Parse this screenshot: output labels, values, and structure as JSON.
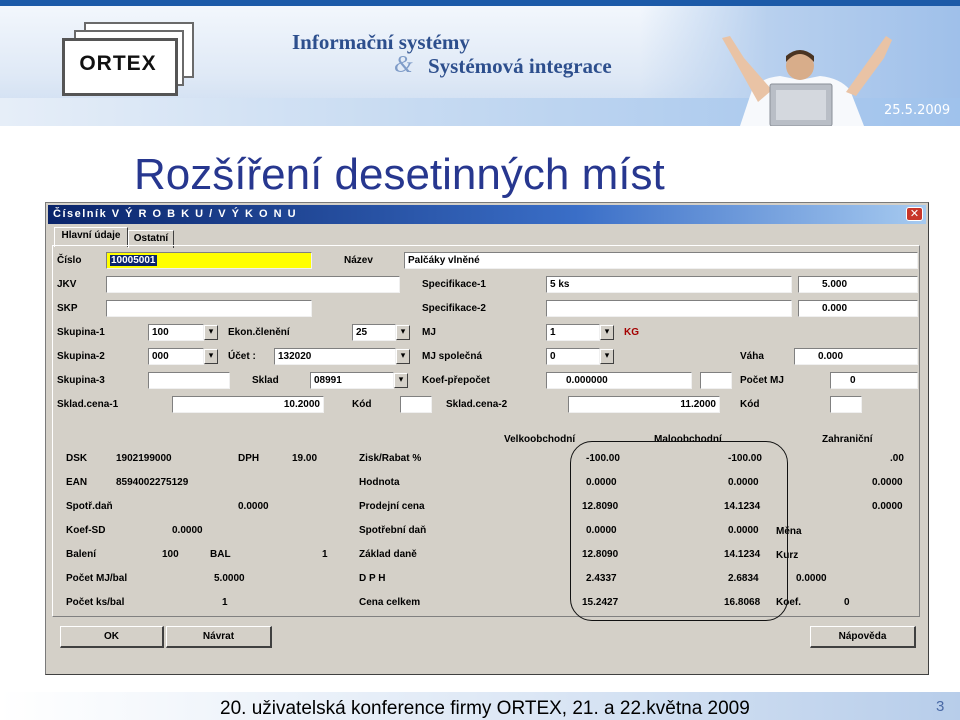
{
  "banner": {
    "logo_text": "ORTEX",
    "tagline_1": "Informační systémy",
    "tagline_amp": "&",
    "tagline_2": "Systémová integrace",
    "date": "25.5.2009"
  },
  "slide": {
    "title": "Rozšíření desetinných míst",
    "footer": "20. uživatelská konference firmy ORTEX, 21. a 22.května 2009",
    "page_number": "3"
  },
  "window": {
    "title": "Číselník   V Ý R O B K U  /  V Ý K O N U",
    "close_glyph": "✕",
    "tabs": [
      "Hlavní údaje",
      "Ostatní"
    ]
  },
  "form": {
    "cislo_label": "Číslo",
    "cislo_value": "10005001",
    "nazev_label": "Název",
    "nazev_value": "Palčáky vlněné",
    "jkv_label": "JKV",
    "jkv_value": "",
    "spec1_label": "Specifikace-1",
    "spec1_value": "5 ks",
    "spec1_right": "5.000",
    "skp_label": "SKP",
    "skp_value": "",
    "spec2_label": "Specifikace-2",
    "spec2_value": "",
    "spec2_right": "0.000",
    "skupina1_label": "Skupina-1",
    "skupina1_value": "100",
    "ekon_label": "Ekon.členění",
    "ekon_value": "25",
    "mj_label": "MJ",
    "mj_value": "1",
    "mj_unit": "KG",
    "skupina2_label": "Skupina-2",
    "skupina2_value": "000",
    "ucet_label": "Účet :",
    "ucet_value": "132020",
    "mj_spol_label": "MJ společná",
    "mj_spol_value": "0",
    "vaha_label": "Váha",
    "vaha_value": "0.000",
    "skupina3_label": "Skupina-3",
    "skupina3_value": "",
    "sklad_label": "Sklad",
    "sklad_value": "08991",
    "koef_label": "Koef-přepočet",
    "koef_value": "0.000000",
    "koef_extra": "",
    "pocet_mj_label": "Počet MJ",
    "pocet_mj_value": "0",
    "skladcena1_label": "Sklad.cena-1",
    "skladcena1_value": "10.2000",
    "kod1_label": "Kód",
    "kod1_value": "",
    "skladcena2_label": "Sklad.cena-2",
    "skladcena2_value": "11.2000",
    "kod2_label": "Kód",
    "kod2_value": ""
  },
  "pricing": {
    "col_headers": [
      "Velkoobchodní",
      "Maloobchodní",
      "Zahraniční"
    ],
    "left": [
      {
        "label": "DSK",
        "value": "1902199000",
        "label2": "DPH",
        "value2": "19.00"
      },
      {
        "label": "EAN",
        "value": "8594002275129"
      },
      {
        "label": "Spotř.daň",
        "value": "0.0000"
      },
      {
        "label": "Koef-SD",
        "value": "0.0000"
      },
      {
        "label": "Balení",
        "value": "100",
        "unit": "BAL",
        "value2": "1"
      },
      {
        "label": "Počet MJ/bal",
        "value": "5.0000"
      },
      {
        "label": "Počet ks/bal",
        "value": "1"
      }
    ],
    "rows": [
      {
        "label": "Zisk/Rabat %",
        "vo": "-100.00",
        "mo": "-100.00",
        "za": ".00"
      },
      {
        "label": "Hodnota",
        "vo": "0.0000",
        "mo": "0.0000",
        "za": "0.0000"
      },
      {
        "label": "Prodejní cena",
        "vo": "12.8090",
        "mo": "14.1234",
        "za": "0.0000"
      },
      {
        "label": "Spotřební daň",
        "vo": "0.0000",
        "mo": "0.0000"
      },
      {
        "label": "Základ daně",
        "vo": "12.8090",
        "mo": "14.1234"
      },
      {
        "label": "D P H",
        "vo": "2.4337",
        "mo": "2.6834"
      },
      {
        "label": "Cena celkem",
        "vo": "15.2427",
        "mo": "16.8068"
      }
    ],
    "mena_label": "Měna",
    "kurz_label": "Kurz",
    "kurz_value": "0.0000",
    "koef_label": "Koef.",
    "koef_value": "0"
  },
  "buttons": {
    "ok": "OK",
    "navrat": "Návrat",
    "napoveda": "Nápověda"
  }
}
